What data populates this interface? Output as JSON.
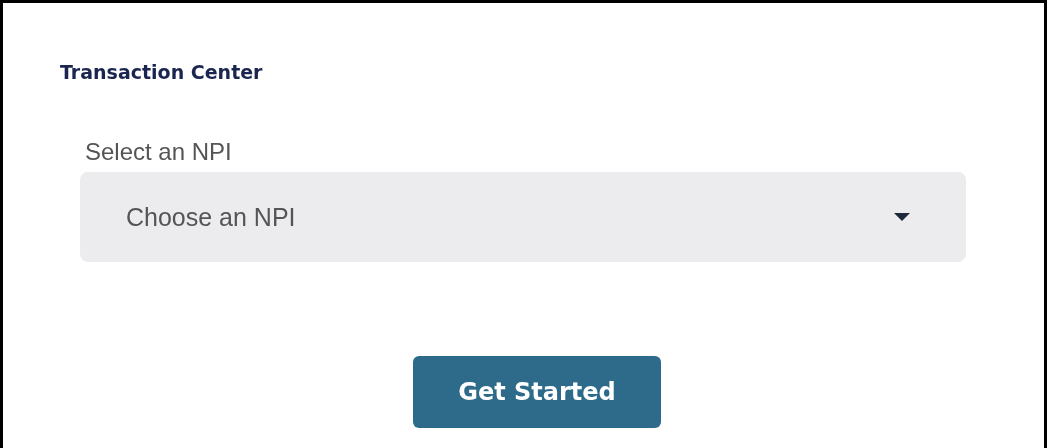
{
  "title": "Transaction Center",
  "npi_select": {
    "label": "Select an NPI",
    "placeholder": "Choose an NPI"
  },
  "button": {
    "label": "Get Started"
  }
}
